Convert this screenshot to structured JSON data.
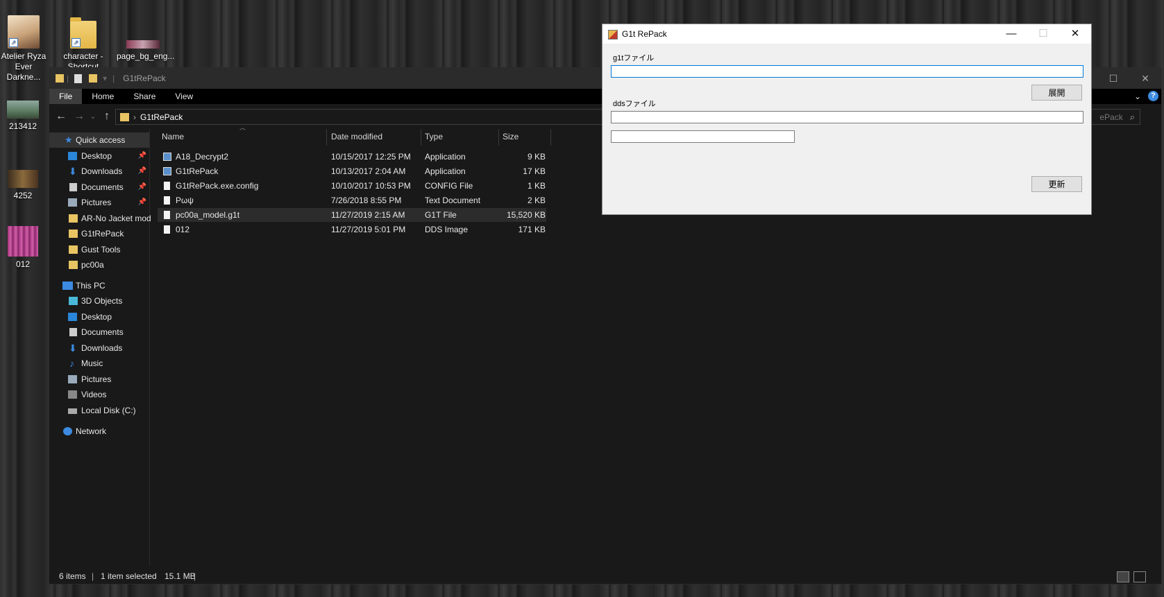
{
  "desktop": {
    "icons": [
      {
        "label": "Atelier Ryza Ever Darkne..."
      },
      {
        "label": "character - Shortcut"
      },
      {
        "label": "page_bg_eng..."
      },
      {
        "label": "213412"
      },
      {
        "label": "4252"
      },
      {
        "label": "012"
      }
    ]
  },
  "explorer": {
    "title": "G1tRePack",
    "ribbon_tabs": [
      "File",
      "Home",
      "Share",
      "View"
    ],
    "address": "G1tRePack",
    "search_placeholder": "ePack",
    "nav": {
      "quick_access": "Quick access",
      "quick_items": [
        "Desktop",
        "Downloads",
        "Documents",
        "Pictures",
        "AR-No Jacket mod",
        "G1tRePack",
        "Gust Tools",
        "pc00a"
      ],
      "this_pc": "This PC",
      "pc_items": [
        "3D Objects",
        "Desktop",
        "Documents",
        "Downloads",
        "Music",
        "Pictures",
        "Videos",
        "Local Disk (C:)"
      ],
      "network": "Network"
    },
    "columns": [
      "Name",
      "Date modified",
      "Type",
      "Size"
    ],
    "files": [
      {
        "name": "A18_Decrypt2",
        "date": "10/15/2017 12:25 PM",
        "type": "Application",
        "size": "9 KB",
        "icon": "app-icon"
      },
      {
        "name": "G1tRePack",
        "date": "10/13/2017 2:04 AM",
        "type": "Application",
        "size": "17 KB",
        "icon": "app-icon"
      },
      {
        "name": "G1tRePack.exe.config",
        "date": "10/10/2017 10:53 PM",
        "type": "CONFIG File",
        "size": "1 KB",
        "icon": "file-icon"
      },
      {
        "name": "Ρωψ",
        "date": "7/26/2018 8:55 PM",
        "type": "Text Document",
        "size": "2 KB",
        "icon": "text-file-icon"
      },
      {
        "name": "pc00a_model.g1t",
        "date": "11/27/2019 2:15 AM",
        "type": "G1T File",
        "size": "15,520 KB",
        "icon": "file-icon",
        "selected": true
      },
      {
        "name": "012",
        "date": "11/27/2019 5:01 PM",
        "type": "DDS Image",
        "size": "171 KB",
        "icon": "image-file-icon"
      }
    ],
    "status": {
      "count": "6 items",
      "selection": "1 item selected",
      "size": "15.1 MB"
    }
  },
  "dialog": {
    "title": "G1t RePack",
    "g1t_label": "g1tファイル",
    "g1t_value": "",
    "expand_button": "展開",
    "dds_label": "ddsファイル",
    "dds_value": "",
    "extra_value": "",
    "update_button": "更新"
  }
}
